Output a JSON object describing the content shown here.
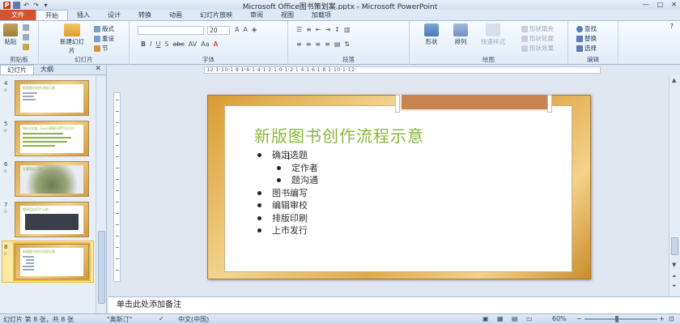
{
  "window": {
    "title": "Microsoft Office图书策划案.pptx - Microsoft PowerPoint",
    "app_icon": "P"
  },
  "tabs": [
    "文件",
    "开始",
    "插入",
    "设计",
    "转换",
    "动画",
    "幻灯片放映",
    "审阅",
    "视图",
    "加载项"
  ],
  "active_tab": "开始",
  "ribbon": {
    "clipboard": {
      "label": "剪贴板",
      "paste": "粘贴"
    },
    "slides": {
      "label": "幻灯片",
      "new_slide": "新建幻灯片",
      "layout": "版式",
      "reset": "重设",
      "section": "节"
    },
    "font": {
      "label": "字体",
      "font_size": "20",
      "name_value": ""
    },
    "paragraph": {
      "label": "段落"
    },
    "drawing": {
      "label": "绘图",
      "shapes": "形状",
      "arrange": "排列",
      "quick_styles": "快速样式",
      "fill": "形状填充",
      "outline": "形状轮廓",
      "effects": "形状效果"
    },
    "editing": {
      "label": "编辑",
      "find": "查找",
      "replace": "替换",
      "select": "选择"
    }
  },
  "left_panel": {
    "tabs": [
      "幻灯片",
      "大纲"
    ],
    "thumbnails": [
      {
        "num": "4",
        "title": "新版图书创作流程示意"
      },
      {
        "num": "5",
        "title": "Word文档、Excel表格与PPT幻灯片"
      },
      {
        "num": "6",
        "title": "主题图片示例"
      },
      {
        "num": "7",
        "title": "图表型幻灯片示例"
      },
      {
        "num": "8",
        "title": "新版图书创作流程示意",
        "selected": true
      }
    ]
  },
  "ruler_text": "·12·1·10·1·8·1·6·1·4·1·2·1·0·1·2·1·4·1·6·1·8·1·10·1·12·",
  "slide": {
    "title": "新版图书创作流程示意",
    "bullets": [
      {
        "text": "确定选题",
        "level": 1
      },
      {
        "text": "定作者",
        "level": 2
      },
      {
        "text": "题沟通",
        "level": 2
      },
      {
        "text": "图书编写",
        "level": 1
      },
      {
        "text": "编辑审校",
        "level": 1
      },
      {
        "text": "排版印刷",
        "level": 1
      },
      {
        "text": "上市发行",
        "level": 1
      }
    ]
  },
  "notes_placeholder": "单击此处添加备注",
  "status": {
    "slide_info": "幻灯片 第 8 张，共 8 张",
    "theme": "\"奥斯汀\"",
    "language": "中文(中国)",
    "zoom": "60%"
  }
}
